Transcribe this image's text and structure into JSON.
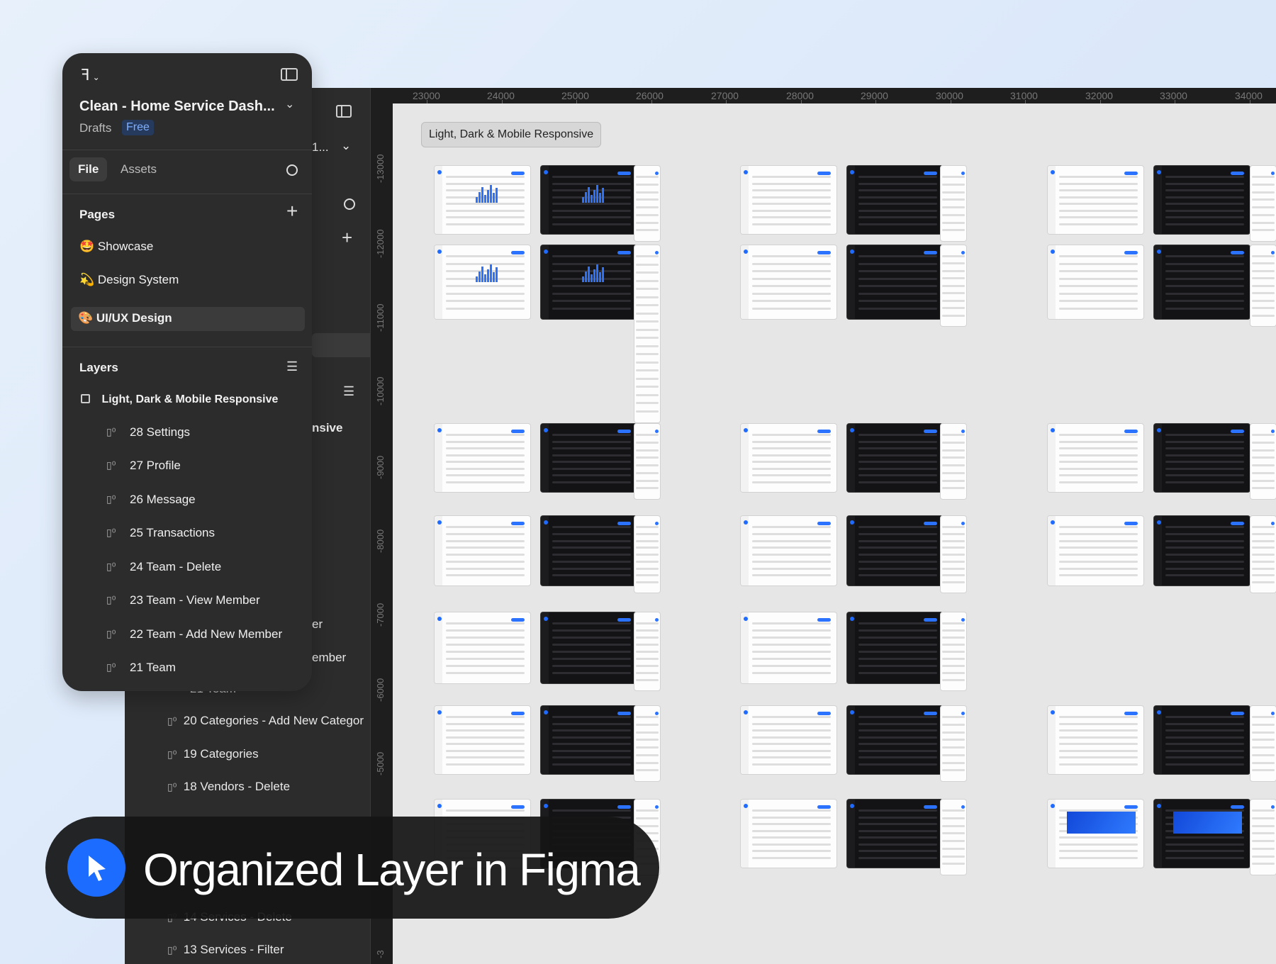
{
  "colors": {
    "accent": "#1c6dff",
    "panel": "#2c2c2c",
    "canvas": "#e6e6e6"
  },
  "app": {
    "file_title": "Clean - Home Service Dash...",
    "drafts_label": "Drafts",
    "plan_badge": "Free",
    "icons": {
      "logo": "figma-logo-icon",
      "sidebar_toggle": "sidebar-toggle-icon",
      "search": "search-icon",
      "add": "plus-icon",
      "collapse": "collapse-icon"
    }
  },
  "tabs": {
    "file": "File",
    "assets": "Assets"
  },
  "pages": {
    "heading": "Pages",
    "items": [
      {
        "emoji": "🤩",
        "label": "Showcase"
      },
      {
        "emoji": "💫",
        "label": "Design System"
      },
      {
        "emoji": "🎨",
        "label": "UI/UX Design"
      }
    ]
  },
  "layers": {
    "heading": "Layers",
    "frame": "Light, Dark & Mobile Responsive",
    "items": [
      "28 Settings",
      "27 Profile",
      "26 Message",
      "25 Transactions",
      "24 Team - Delete",
      "23 Team - View Member",
      "22 Team - Add New Member",
      "21 Team"
    ]
  },
  "back_panel": {
    "title_fragment": "1...",
    "frame_fragment": "nsive",
    "frag_1": "er",
    "frag_2": "ember",
    "frag_3": "21 Team",
    "items": [
      "20 Categories - Add New Categor",
      "19 Categories",
      "18 Vendors - Delete",
      "14 Services - Delete",
      "13 Services - Filter"
    ]
  },
  "ruler": {
    "horizontal": [
      "23000",
      "24000",
      "25000",
      "26000",
      "27000",
      "28000",
      "29000",
      "30000",
      "31000",
      "32000",
      "33000",
      "34000"
    ],
    "vertical": [
      "-13000",
      "-12000",
      "-11000",
      "-10000",
      "-9000",
      "-8000",
      "-7000",
      "-6000",
      "-5000",
      "-3"
    ]
  },
  "canvas": {
    "frame_label": "Light, Dark & Mobile Responsive"
  },
  "banner": {
    "text": "Organized Layer in Figma"
  }
}
